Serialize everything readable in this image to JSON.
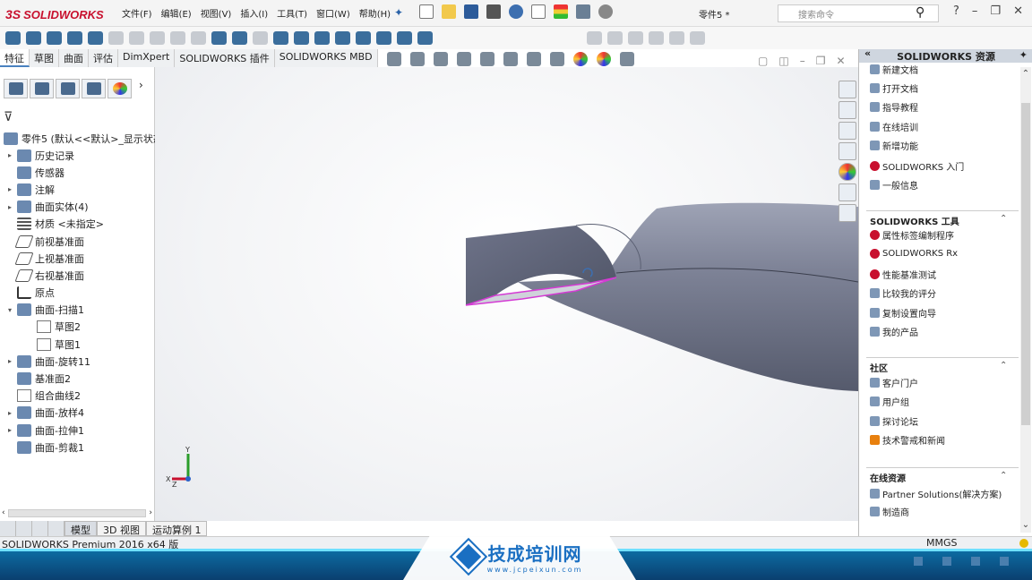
{
  "app": {
    "logo": "SOLIDWORKS",
    "doc_title": "零件5 *",
    "search_placeholder": "搜索命令"
  },
  "menu": [
    "文件(F)",
    "编辑(E)",
    "视图(V)",
    "插入(I)",
    "工具(T)",
    "窗口(W)",
    "帮助(H)"
  ],
  "tabs": [
    {
      "label": "特征",
      "active": true
    },
    {
      "label": "草图"
    },
    {
      "label": "曲面"
    },
    {
      "label": "评估"
    },
    {
      "label": "DimXpert"
    },
    {
      "label": "SOLIDWORKS 插件"
    },
    {
      "label": "SOLIDWORKS MBD"
    }
  ],
  "tree": {
    "root": "零件5 (默认<<默认>_显示状态",
    "items": [
      {
        "label": "历史记录",
        "exp": true,
        "depth": 0
      },
      {
        "label": "传感器",
        "exp": false,
        "depth": 0
      },
      {
        "label": "注解",
        "exp": true,
        "depth": 0
      },
      {
        "label": "曲面实体(4)",
        "exp": true,
        "depth": 0
      },
      {
        "label": "材质 <未指定>",
        "exp": false,
        "depth": 0,
        "icon": "mat"
      },
      {
        "label": "前视基准面",
        "exp": false,
        "depth": 0,
        "icon": "plane"
      },
      {
        "label": "上视基准面",
        "exp": false,
        "depth": 0,
        "icon": "plane"
      },
      {
        "label": "右视基准面",
        "exp": false,
        "depth": 0,
        "icon": "plane"
      },
      {
        "label": "原点",
        "exp": false,
        "depth": 0,
        "icon": "origin"
      },
      {
        "label": "曲面-扫描1",
        "exp": "open",
        "depth": 0
      },
      {
        "label": "草图2",
        "exp": false,
        "depth": 1,
        "icon": "sk"
      },
      {
        "label": "草图1",
        "exp": false,
        "depth": 1,
        "icon": "sk"
      },
      {
        "label": "曲面-旋转11",
        "exp": true,
        "depth": 0
      },
      {
        "label": "基准面2",
        "exp": false,
        "depth": 0
      },
      {
        "label": "组合曲线2",
        "exp": false,
        "depth": 0,
        "icon": "sk"
      },
      {
        "label": "曲面-放样4",
        "exp": true,
        "depth": 0
      },
      {
        "label": "曲面-拉伸1",
        "exp": true,
        "depth": 0
      },
      {
        "label": "曲面-剪裁1",
        "exp": false,
        "depth": 0
      }
    ]
  },
  "bottom_tabs": [
    {
      "label": "模型",
      "active": true
    },
    {
      "label": "3D 视图"
    },
    {
      "label": "运动算例 1"
    }
  ],
  "triad": {
    "y": "Y",
    "x": "X",
    "z": "Z"
  },
  "taskpane": {
    "title": "SOLIDWORKS 资源",
    "top_items": [
      "新建文档",
      "打开文档",
      "指导教程",
      "在线培训",
      "新增功能",
      "SOLIDWORKS 入门",
      "一般信息"
    ],
    "tools_title": "SOLIDWORKS 工具",
    "tools_items": [
      "属性标签编制程序",
      "SOLIDWORKS Rx",
      "性能基准测试",
      "比较我的评分",
      "复制设置向导",
      "我的产品"
    ],
    "community_title": "社区",
    "community_items": [
      "客户门户",
      "用户组",
      "探讨论坛",
      "技术警戒和新闻"
    ],
    "online_title": "在线资源",
    "online_items": [
      "Partner Solutions(解决方案)",
      "制造商"
    ]
  },
  "status": {
    "version": "SOLIDWORKS Premium 2016 x64 版",
    "units": "MMGS"
  },
  "watermark": {
    "title": "技成培训网",
    "url": "www.jcpeixun.com"
  }
}
